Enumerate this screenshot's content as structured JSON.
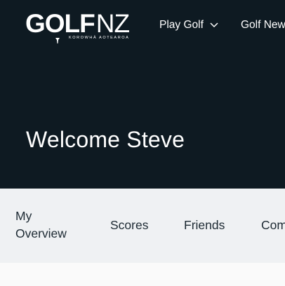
{
  "brand": {
    "logo_main": "GOLF",
    "logo_nz": "NZ",
    "logo_sub": "KOROWHĀ AOTEAROA"
  },
  "nav": {
    "items": [
      {
        "label": "Play Golf",
        "icon": "chevron-down-icon"
      },
      {
        "label": "Golf New"
      }
    ]
  },
  "hero": {
    "welcome": "Welcome Steve"
  },
  "tabs": {
    "overview_line1": "My",
    "overview_line2": "Overview",
    "scores": "Scores",
    "friends": "Friends",
    "comp": "Com"
  },
  "colors": {
    "header_bg": "#0e1a22",
    "tabs_bg": "#eff1f3",
    "text_dark": "#1d2a33"
  }
}
